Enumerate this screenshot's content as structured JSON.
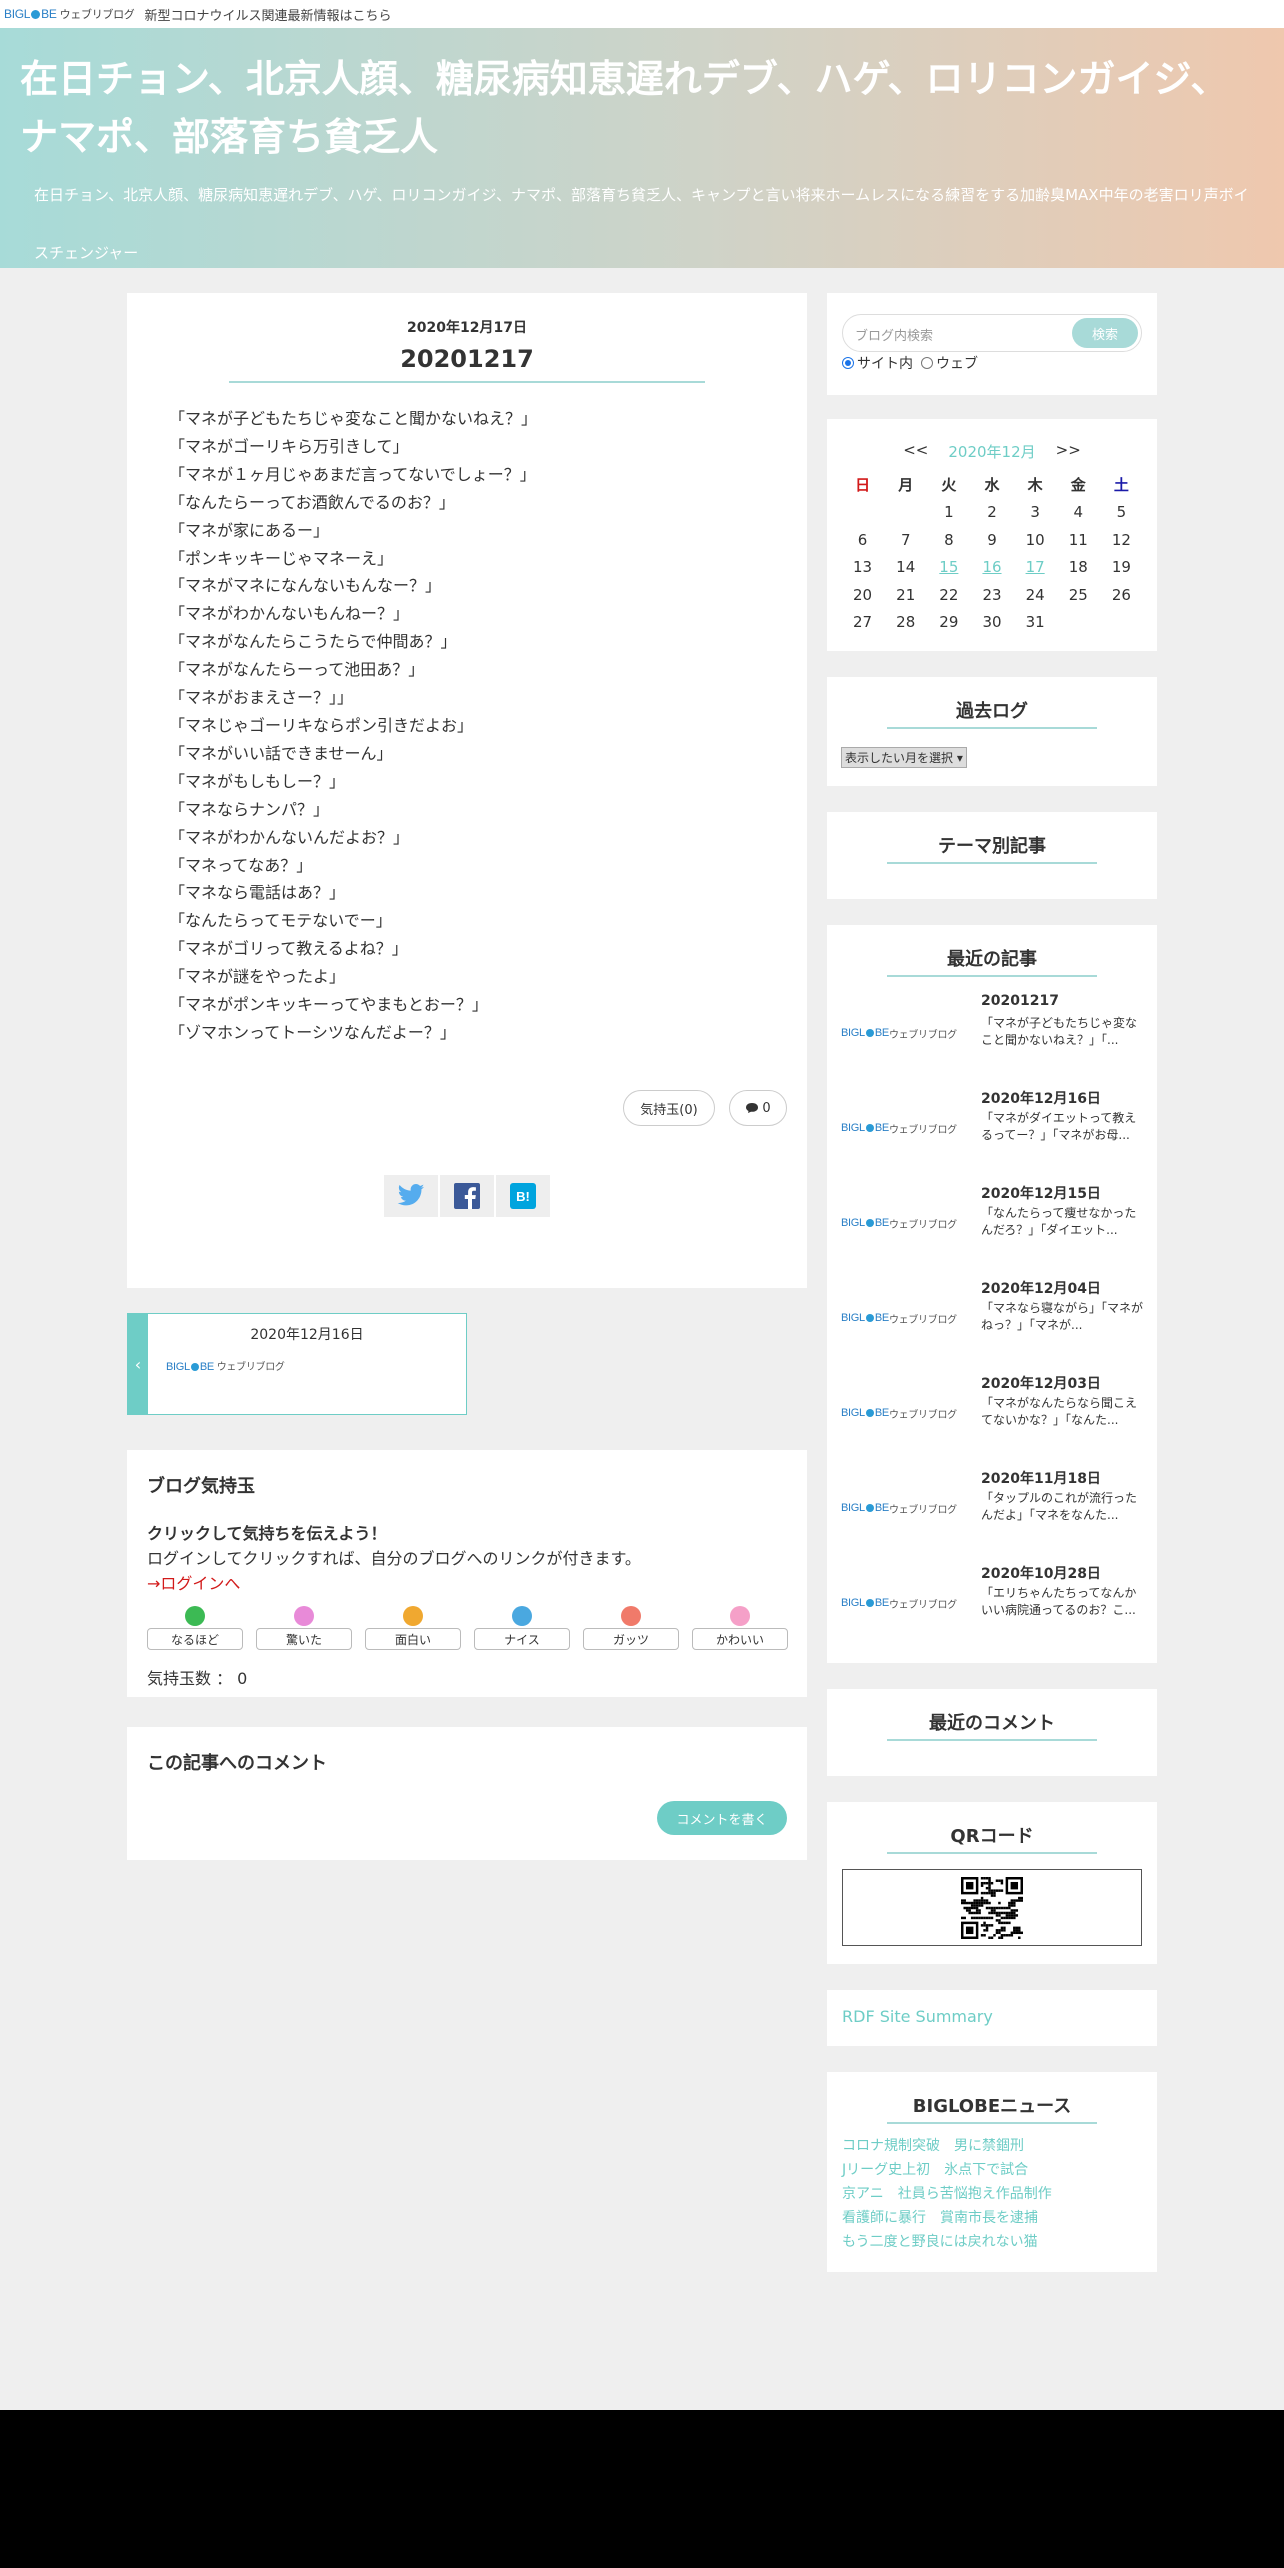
{
  "topbar": {
    "logo_text": "BIGLOBE",
    "logo_sub": "ウェブリブログ",
    "notice": "新型コロナウイルス関連最新情報はこちら"
  },
  "header": {
    "title": "在日チョン、北京人顔、糖尿病知恵遅れデブ、ハゲ、ロリコンガイジ、ナマポ、部落育ち貧乏人",
    "description": "在日チョン、北京人顔、糖尿病知恵遅れデブ、ハゲ、ロリコンガイジ、ナマポ、部落育ち貧乏人、キャンプと言い将来ホームレスになる練習をする加齢臭MAX中年の老害ロリ声ボイスチェンジャー"
  },
  "article": {
    "date": "2020年12月17日",
    "title": "20201217",
    "lines": [
      "「マネが子どもたちじゃ変なこと聞かないねえ？」",
      "「マネがゴーリキら万引きして」",
      "「マネが１ヶ月じゃあまだ言ってないでしょー？」",
      "「なんたらーってお酒飲んでるのお？」",
      "「マネが家にあるー」",
      "「ポンキッキーじゃマネーえ」",
      "「マネがマネになんないもんなー？」",
      "「マネがわかんないもんねー？」",
      "「マネがなんたらこうたらで仲間あ？」",
      "「マネがなんたらーって池田あ？」",
      "「マネがおまえさー？」」",
      "「マネじゃゴーリキならポン引きだよお」",
      "「マネがいい話できませーん」",
      "「マネがもしもしー？」",
      "「マネならナンパ？」",
      "「マネがわかんないんだよお？」",
      "「マネってなあ？」",
      "「マネなら電話はあ？」",
      "「なんたらってモテないでー」",
      "「マネがゴリって教えるよね？」",
      "「マネが謎をやったよ」",
      "「マネがポンキッキーってやまもとおー？」",
      "「ゾマホンってトーシツなんだよー？」"
    ],
    "kimochi_label": "気持玉(0)",
    "comment_count": "0"
  },
  "prev_post": {
    "date": "2020年12月16日",
    "arrow": "‹"
  },
  "kimochi": {
    "heading": "ブログ気持玉",
    "lead": "クリックして気持ちを伝えよう！",
    "lead2": "ログインしてクリックすれば、自分のブログへのリンクが付きます。",
    "login": "→ログインへ",
    "buttons": [
      {
        "label": "なるほど",
        "color": "#3cba54"
      },
      {
        "label": "驚いた",
        "color": "#e88ad8"
      },
      {
        "label": "面白い",
        "color": "#f0a830"
      },
      {
        "label": "ナイス",
        "color": "#4aa8e0"
      },
      {
        "label": "ガッツ",
        "color": "#f07a6a"
      },
      {
        "label": "かわいい",
        "color": "#f5a0c8"
      }
    ],
    "count": "気持玉数 ： 0"
  },
  "comment": {
    "heading": "この記事へのコメント",
    "button": "コメントを書く"
  },
  "search": {
    "placeholder": "ブログ内検索",
    "button": "検索",
    "radio_site": "サイト内",
    "radio_web": "ウェブ"
  },
  "calendar": {
    "prev": "<<",
    "month": "2020年12月",
    "next": ">>",
    "weekdays": [
      "日",
      "月",
      "火",
      "水",
      "木",
      "金",
      "土"
    ],
    "weeks": [
      [
        "",
        "",
        "1",
        "2",
        "3",
        "4",
        "5"
      ],
      [
        "6",
        "7",
        "8",
        "9",
        "10",
        "11",
        "12"
      ],
      [
        "13",
        "14",
        "15",
        "16",
        "17",
        "18",
        "19"
      ],
      [
        "20",
        "21",
        "22",
        "23",
        "24",
        "25",
        "26"
      ],
      [
        "27",
        "28",
        "29",
        "30",
        "31",
        "",
        ""
      ]
    ],
    "linked_days": [
      "15",
      "16",
      "17"
    ]
  },
  "archive": {
    "heading": "過去ログ",
    "select": "表示したい月を選択"
  },
  "theme": {
    "heading": "テーマ別記事"
  },
  "recent": {
    "heading": "最近の記事",
    "items": [
      {
        "title": "20201217",
        "snippet": "「マネが子どもたちじゃ変なこと聞かないねえ？」「..."
      },
      {
        "title": "2020年12月16日",
        "snippet": "「マネがダイエットって教えるってー？」「マネがお母..."
      },
      {
        "title": "2020年12月15日",
        "snippet": "「なんたらって痩せなかったんだろ？」「ダイエット..."
      },
      {
        "title": "2020年12月04日",
        "snippet": "「マネなら寝ながら」「マネがねっ？」「マネが..."
      },
      {
        "title": "2020年12月03日",
        "snippet": "「マネがなんたらなら聞こえてないかな？」「なんた..."
      },
      {
        "title": "2020年11月18日",
        "snippet": "「タップルのこれが流行ったんだよ」「マネをなんた..."
      },
      {
        "title": "2020年10月28日",
        "snippet": "「エリちゃんたちってなんかいい病院通ってるのお？こ..."
      }
    ]
  },
  "recent_comments": {
    "heading": "最近のコメント"
  },
  "qr": {
    "heading": "QRコード"
  },
  "rdf": {
    "link": "RDF Site Summary"
  },
  "news": {
    "heading": "BIGLOBEニュース",
    "items": [
      "コロナ規制突破　男に禁錮刑",
      "Jリーグ史上初　氷点下で試合",
      "京アニ　社員ら苦悩抱え作品制作",
      "看護師に暴行　賞南市長を逮捕",
      "もう二度と野良には戻れない猫"
    ]
  },
  "colors": {
    "accent": "#6ecdc6",
    "accent_light": "#a8dad8",
    "header_left": "#a7dbd8",
    "header_right": "#efc8ae",
    "login_red": "#d21a1a"
  }
}
